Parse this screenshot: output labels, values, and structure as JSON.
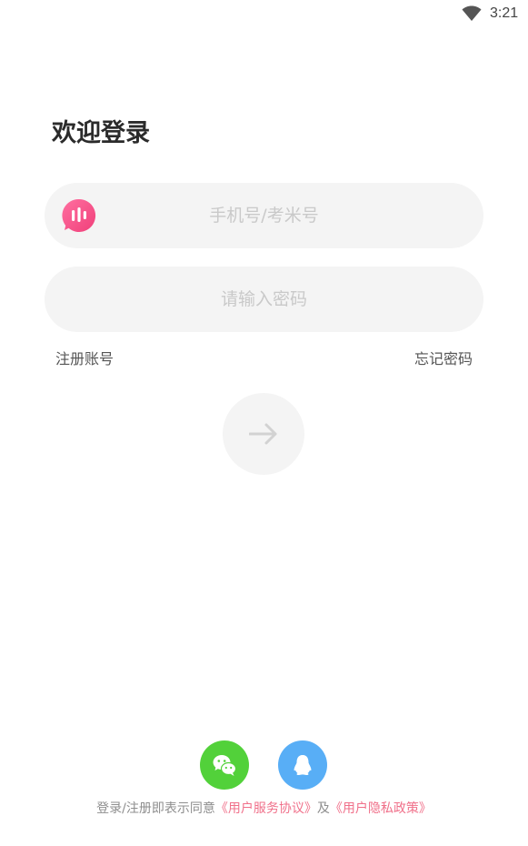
{
  "status_bar": {
    "time": "3:21",
    "wifi_icon": "wifi-icon"
  },
  "login": {
    "title": "欢迎登录",
    "phone_placeholder": "手机号/考米号",
    "phone_value": "",
    "password_placeholder": "请输入密码",
    "password_value": "",
    "app_logo_icon": "app-logo-icon",
    "register_label": "注册账号",
    "forgot_label": "忘记密码",
    "submit_icon": "arrow-right-icon"
  },
  "social": {
    "wechat_icon": "wechat-icon",
    "qq_icon": "qq-icon"
  },
  "agreement": {
    "prefix": "登录/注册即表示同意",
    "service_link": "《用户服务协议》",
    "joiner": "及",
    "privacy_link": "《用户隐私政策》"
  },
  "colors": {
    "accent_pink": "#f0708a",
    "wechat_green": "#52d13a",
    "qq_blue": "#58aef6",
    "field_background": "#f4f4f4"
  }
}
